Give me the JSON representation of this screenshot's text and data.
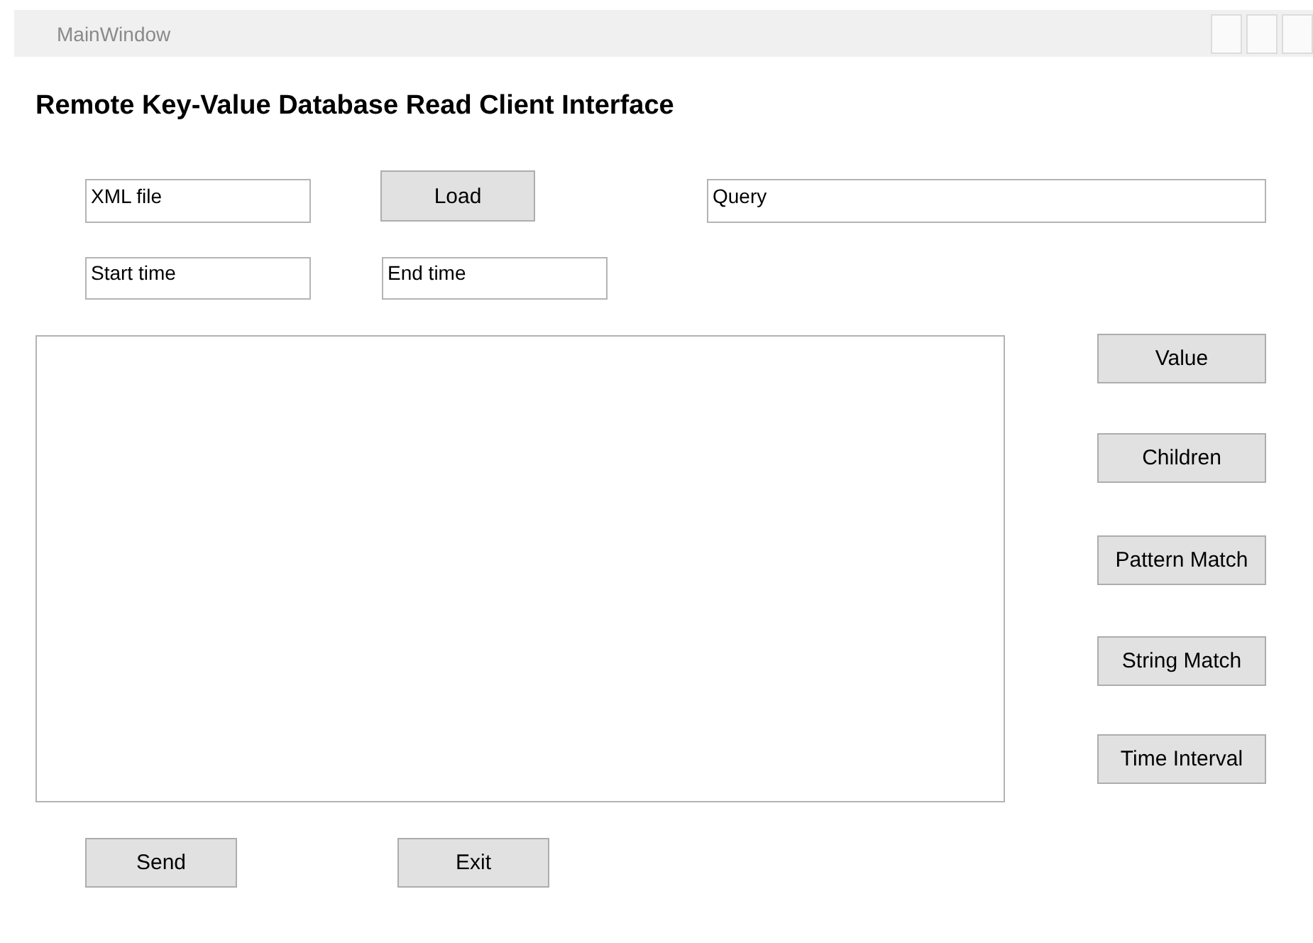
{
  "window": {
    "title": "MainWindow"
  },
  "heading": "Remote Key-Value Database Read Client Interface",
  "file_field": {
    "value": "XML file"
  },
  "load_button": "Load",
  "query_field": {
    "value": "Query"
  },
  "start_field": {
    "value": "Start time"
  },
  "end_field": {
    "value": "End time"
  },
  "action_buttons": [
    "Value",
    "Children",
    "Pattern Match",
    "String Match",
    "Time Interval"
  ],
  "bottom_buttons": [
    "Send",
    "Exit"
  ]
}
